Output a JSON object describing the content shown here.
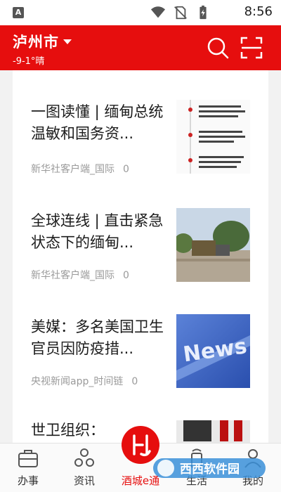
{
  "status_bar": {
    "badge": "A",
    "time": "8:56",
    "icons": [
      "wifi-icon",
      "no-sim-icon",
      "battery-charging-icon"
    ]
  },
  "header": {
    "city": "泸州市",
    "weather": "-9-1°晴",
    "background": "#e60e0e",
    "icons": [
      "search-icon",
      "scan-icon"
    ]
  },
  "feed": {
    "items": [
      {
        "title": "一图读懂 | 缅甸总统温敏和国务资...",
        "source": "新华社客户端_国际",
        "count": "0",
        "thumb": "infographic"
      },
      {
        "title": "全球连线 | 直击紧急状态下的缅甸...",
        "source": "新华社客户端_国际",
        "count": "0",
        "thumb": "road-photo"
      },
      {
        "title": "美媒：多名美国卫生官员因防疫措...",
        "source": "央视新闻app_时间链",
        "count": "0",
        "thumb": "news-graphic"
      },
      {
        "title": "世卫组织：",
        "source": "",
        "count": "",
        "thumb": "lab-photo"
      }
    ]
  },
  "bottom_nav": {
    "items": [
      {
        "label": "办事",
        "icon": "briefcase-icon"
      },
      {
        "label": "资讯",
        "icon": "people-icon"
      },
      {
        "label": "酒城e通",
        "icon": "logo-icon"
      },
      {
        "label": "生活",
        "icon": "phone-icon"
      },
      {
        "label": "我的",
        "icon": "profile-icon"
      }
    ],
    "active": "酒城e通",
    "accent": "#e60e0e"
  },
  "watermark": "西西软件园"
}
